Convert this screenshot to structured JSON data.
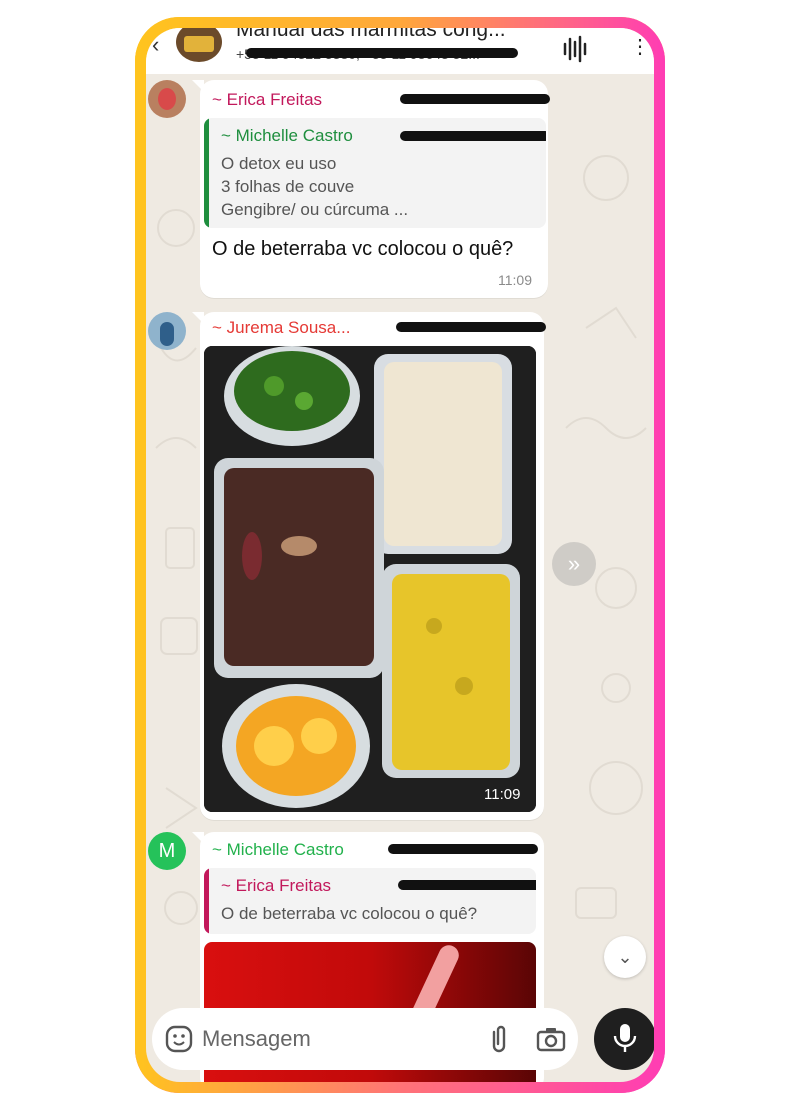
{
  "header": {
    "back_icon": "‹",
    "group_title": "Manual das marmitas cong...",
    "participants": "+55 11 94322 5380, +55 11 98643 52...",
    "call_icon": "audio-wave-icon",
    "more_icon": "⋮"
  },
  "messages": [
    {
      "sender": "~ Erica Freitas",
      "sender_color": "#c2185b",
      "phone_redacted": true,
      "quote": {
        "name": "~ Michelle Castro",
        "color": "#1e8e3e",
        "lines": [
          "O detox eu uso",
          "3 folhas de couve",
          "Gengibre/ ou cúrcuma ..."
        ]
      },
      "text": "O de beterraba vc colocou o quê?",
      "time": "11:09"
    },
    {
      "sender": "~ Jurema Sousa...",
      "sender_color": "#e53935",
      "phone_redacted": true,
      "photo_alt": "marmitas: couve, arroz, feijoada, farofa, laranja",
      "time": "11:09"
    },
    {
      "avatar_letter": "M",
      "sender": "~ Michelle Castro",
      "sender_color": "#22b14c",
      "phone_redacted": true,
      "quote": {
        "name": "~ Erica Freitas",
        "color": "#c2185b",
        "lines": [
          "O de beterraba vc colocou o quê?"
        ]
      }
    }
  ],
  "forward_icon": "»",
  "scroll_down_icon": "⌄",
  "composer": {
    "placeholder": "Mensagem",
    "sticker_icon": "sticker-icon",
    "attach_icon": "paperclip-icon",
    "camera_icon": "camera-icon",
    "mic_icon": "microphone-icon"
  },
  "colors": {
    "frame_top": "#ffc21a",
    "frame_bottom": "#ff3fb2",
    "chat_bg": "#efeae2"
  }
}
